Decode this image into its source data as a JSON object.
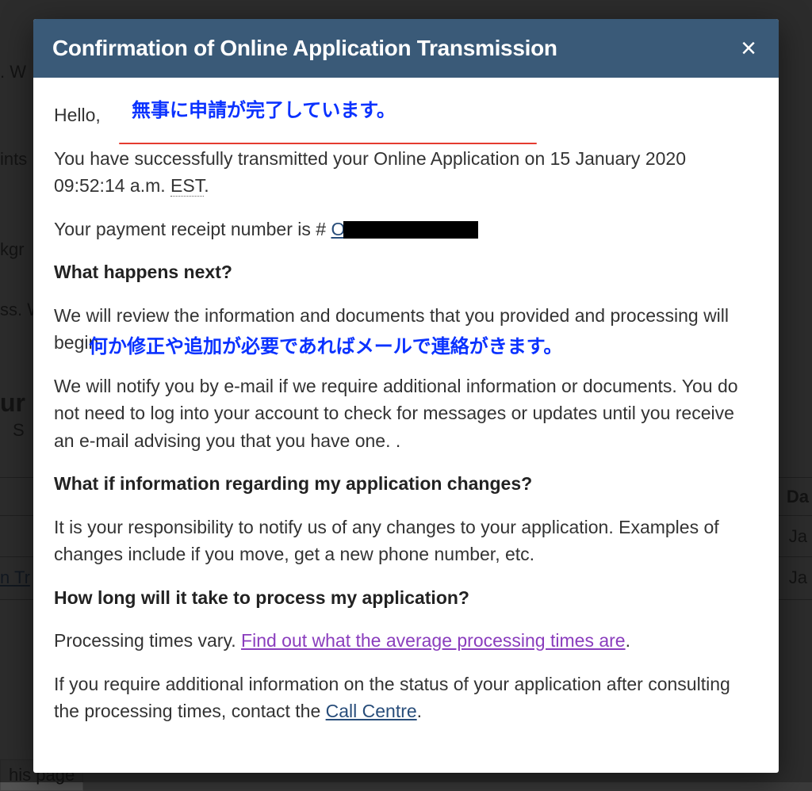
{
  "modal": {
    "title": "Confirmation of Online Application Transmission",
    "close_label": "×",
    "greeting": "Hello,",
    "para1_prefix": "You have ",
    "para1_underlined": "successfully transmitted your Online Application",
    "para1_suffix1": " on 15 January 2020 09:52:14 a.m. ",
    "para1_est": "EST",
    "para1_suffix2": ".",
    "receipt_prefix": "Your payment receipt number is # ",
    "receipt_link_text": "O",
    "heading1": "What happens next?",
    "next1": "We will review the information and documents that you provided and processing will begin.",
    "next2": "We will notify you by e-mail if we require additional information or documents. You do not need to log into your account to check for messages or updates until you receive an e-mail advising you that you have one. .",
    "heading2": "What if information regarding my application changes?",
    "changes1": "It is your responsibility to notify us of any changes to your application. Examples of changes include if you move, get a new phone number, etc.",
    "heading3": "How long will it take to process my application?",
    "proc_prefix": "Processing times vary. ",
    "proc_link": "Find out what the average processing times are",
    "proc_suffix": ".",
    "contact_prefix": "If you require additional information on the status of your application after consulting the processing times, contact the ",
    "contact_link": "Call Centre",
    "contact_suffix": "."
  },
  "annotations": {
    "anno1": "無事に申請が完了しています。",
    "anno2": "何か修正や追加が必要であればメールで連絡がきます。"
  },
  "background": {
    "frag_w": ". W",
    "frag_ints": "ints",
    "frag_kgr": "kgr",
    "frag_ssw": "ss. W",
    "frag_ur": "ur",
    "frag_s": "S",
    "frag_da": "Da",
    "frag_ja1": "Ja",
    "frag_ntr": "n Tr",
    "frag_ja2": "Ja",
    "frag_hispage": "his page"
  }
}
